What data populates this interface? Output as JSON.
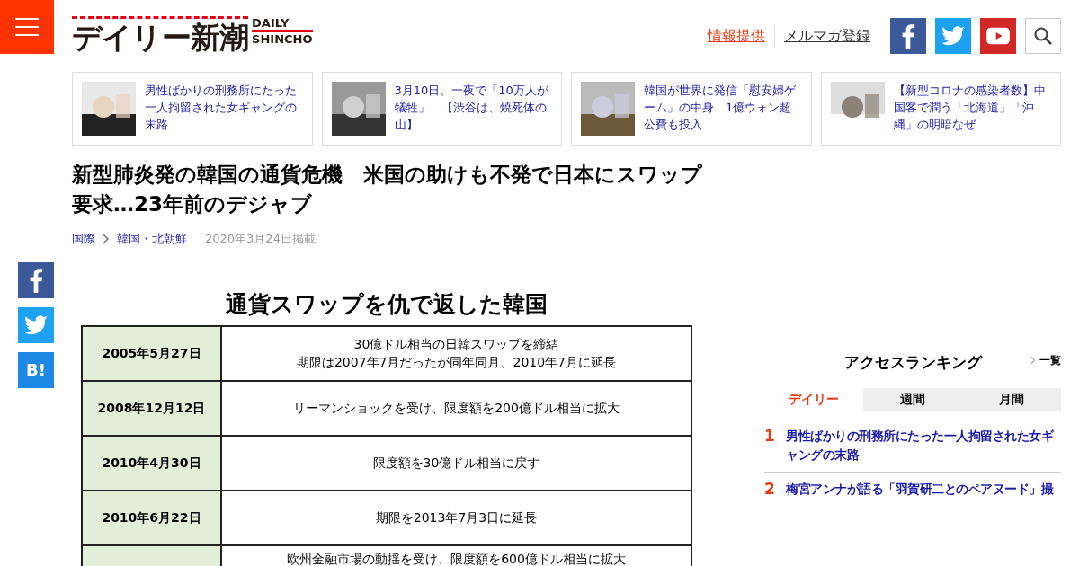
{
  "header": {
    "logo": {
      "name": "デイリー新潮",
      "sub_top": "DAILY",
      "sub_bottom": "SHINCHO"
    },
    "links": [
      {
        "label": "情報提供",
        "kind": "accent"
      },
      {
        "label": "メルマガ登録",
        "kind": "plain"
      }
    ],
    "social": [
      {
        "kind": "facebook"
      },
      {
        "kind": "twitter"
      },
      {
        "kind": "youtube"
      }
    ]
  },
  "related": [
    {
      "title": "男性ばかりの刑務所にたった一人拘留された女ギャングの末路",
      "kind": "picture"
    },
    {
      "title": "3月10日、一夜で「10万人が犠牲」　【渋谷は、焼死体の山】",
      "kind": "picture"
    },
    {
      "title": "韓国が世界に発信「慰安婦ゲーム」の中身　1億ウォン超公費も投入",
      "kind": "picture"
    },
    {
      "title": "【新型コロナの感染者数】中国客で潤う「北海道」「沖縄」の明暗なぜ",
      "kind": "picture"
    }
  ],
  "article": {
    "title": "新型肺炎発の韓国の通貨危機　米国の助けも不発で日本にスワップ要求…23年前のデジャブ",
    "breadcrumb": [
      "国際",
      "韓国・北朝鮮"
    ],
    "date": "2020年3月24日掲載"
  },
  "share": [
    {
      "kind": "facebook"
    },
    {
      "kind": "twitter"
    },
    {
      "kind": "hatena",
      "label": "B!"
    }
  ],
  "figure": {
    "title": "通貨スワップを仇で返した韓国",
    "rows": [
      {
        "date": "2005年5月27日",
        "lines": [
          "30億ドル相当の日韓スワップを締結",
          "期限は2007年7月だったが同年同月、2010年7月に延長"
        ]
      },
      {
        "date": "2008年12月12日",
        "lines": [
          "リーマンショックを受け、限度額を200億ドル相当に拡大"
        ]
      },
      {
        "date": "2010年4月30日",
        "lines": [
          "限度額を30億ドル相当に戻す"
        ]
      },
      {
        "date": "2010年6月22日",
        "lines": [
          "期限を2013年7月3日に延長"
        ]
      },
      {
        "lines": [
          "欧州金融市場の動揺を受け、限度額を600億ドル相当に拡大"
        ]
      }
    ]
  },
  "ranking": {
    "title": "アクセスランキング",
    "more": "一覧",
    "tabs": [
      {
        "label": "デイリー",
        "selected": true
      },
      {
        "label": "週間",
        "selected": false
      },
      {
        "label": "月間",
        "selected": false
      }
    ],
    "items": [
      {
        "rank": "1",
        "title": "男性ばかりの刑務所にたった一人拘留された女ギャングの末路"
      },
      {
        "rank": "2",
        "title": "梅宮アンナが語る「羽賀研二とのペアヌード」撮"
      }
    ]
  }
}
